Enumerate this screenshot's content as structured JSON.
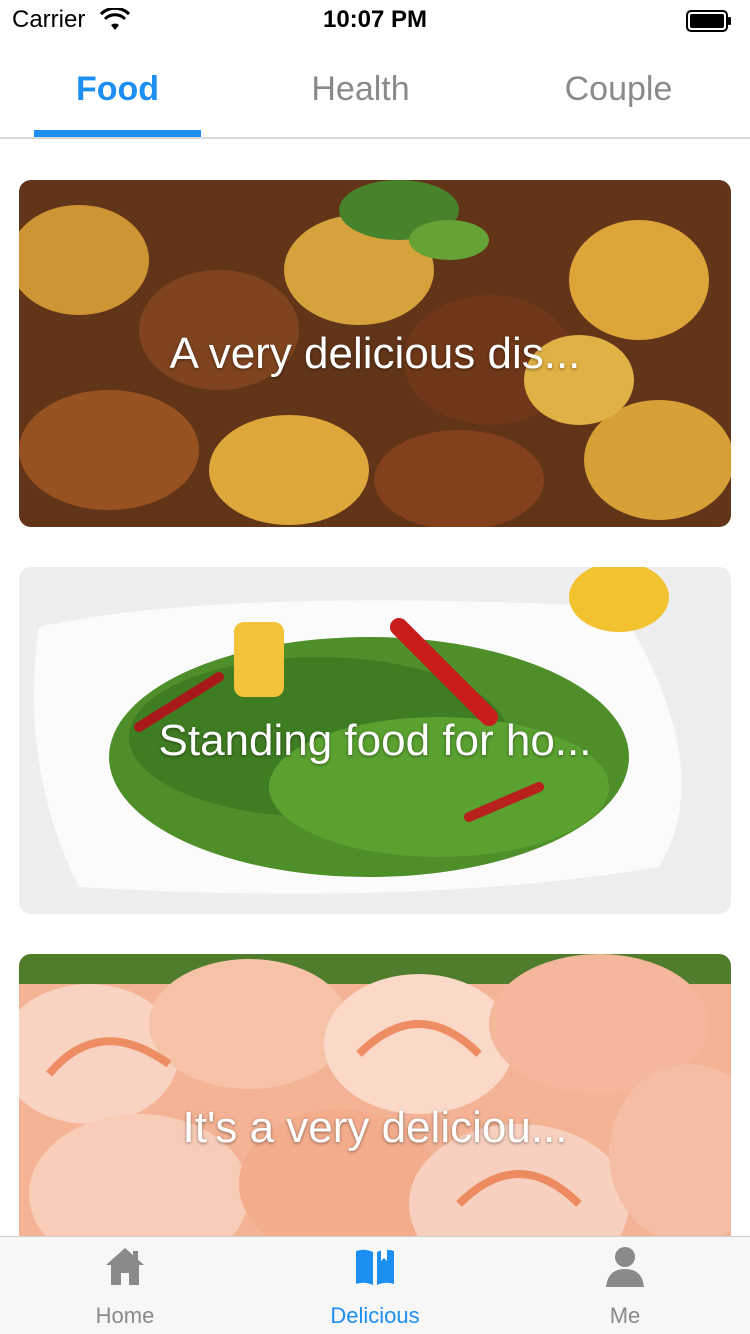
{
  "status_bar": {
    "carrier": "Carrier",
    "time": "10:07 PM",
    "icons": [
      "wifi-icon",
      "battery-icon"
    ]
  },
  "top_tabs": {
    "items": [
      {
        "label": "Food",
        "active": true
      },
      {
        "label": "Health",
        "active": false
      },
      {
        "label": "Couple",
        "active": false
      }
    ]
  },
  "feed": {
    "cards": [
      {
        "title": "A very delicious dis...",
        "image": "braised pork with potatoes photo"
      },
      {
        "title": "Standing food for ho...",
        "image": "stir-fried green beans with chili photo"
      },
      {
        "title": "It's a very deliciou...",
        "image": "peeled shrimp photo"
      }
    ]
  },
  "tab_bar": {
    "items": [
      {
        "label": "Home",
        "icon": "house-icon",
        "active": false
      },
      {
        "label": "Delicious",
        "icon": "book-icon",
        "active": true
      },
      {
        "label": "Me",
        "icon": "person-icon",
        "active": false
      }
    ]
  },
  "colors": {
    "accent": "#1e8ff2",
    "inactive": "#8a8a8a"
  }
}
